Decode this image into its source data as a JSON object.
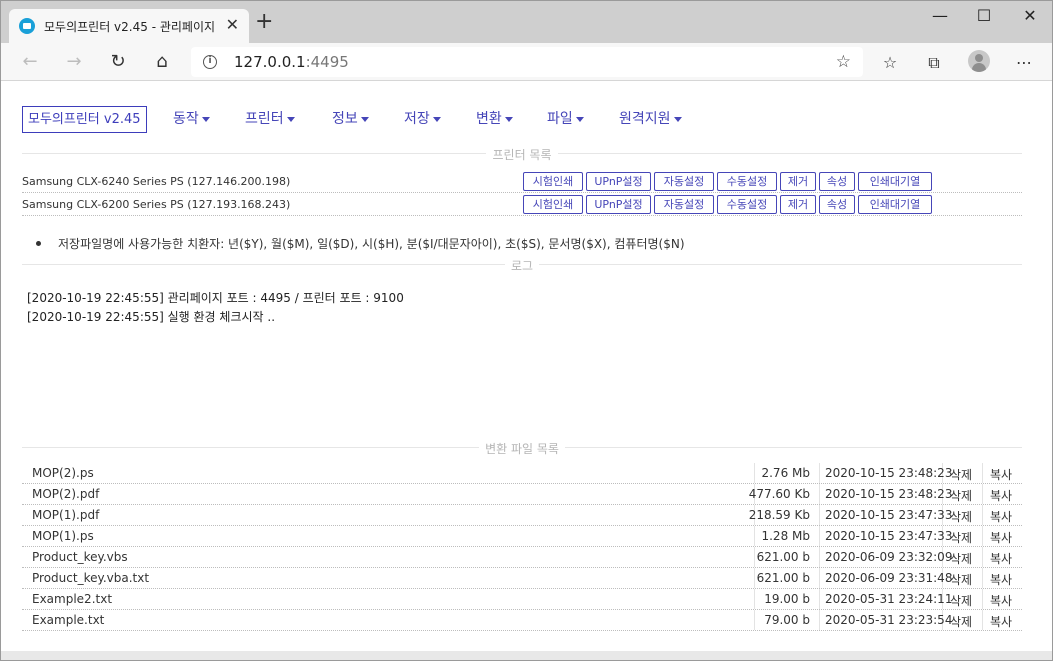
{
  "browser": {
    "tab_title": "모두의프린터 v2.45 - 관리페이지",
    "url_host": "127.0.0.1",
    "url_port": ":4495"
  },
  "navbar": {
    "brand": "모두의프린터 v2.45",
    "menus": [
      "동작",
      "프린터",
      "정보",
      "저장",
      "변환",
      "파일",
      "원격지원"
    ]
  },
  "printers": {
    "title": "프린터 목록",
    "button_labels": [
      "시험인쇄",
      "UPnP설정",
      "자동설정",
      "수동설정",
      "제거",
      "속성",
      "인쇄대기열"
    ],
    "rows": [
      {
        "name": "Samsung CLX-6240 Series PS (127.146.200.198)"
      },
      {
        "name": "Samsung CLX-6200 Series PS (127.193.168.243)"
      }
    ]
  },
  "note": "저장파일명에 사용가능한 치환자: 년($Y), 월($M), 일($D), 시($H), 분($I/대문자아이), 초($S), 문서명($X), 컴퓨터명($N)",
  "log": {
    "title": "로그",
    "lines": [
      "[2020-10-19 22:45:55] 관리페이지 포트 : 4495 / 프린터 포트 : 9100",
      "[2020-10-19 22:45:55] 실행 환경 체크시작 .."
    ]
  },
  "files": {
    "title": "변환 파일 목록",
    "delete_label": "삭제",
    "copy_label": "복사",
    "rows": [
      {
        "name": "MOP(2).ps",
        "size": "2.76 Mb",
        "date": "2020-10-15 23:48:23"
      },
      {
        "name": "MOP(2).pdf",
        "size": "477.60 Kb",
        "date": "2020-10-15 23:48:23"
      },
      {
        "name": "MOP(1).pdf",
        "size": "218.59 Kb",
        "date": "2020-10-15 23:47:33"
      },
      {
        "name": "MOP(1).ps",
        "size": "1.28 Mb",
        "date": "2020-10-15 23:47:33"
      },
      {
        "name": "Product_key.vbs",
        "size": "621.00 b",
        "date": "2020-06-09 23:32:09"
      },
      {
        "name": "Product_key.vba.txt",
        "size": "621.00 b",
        "date": "2020-06-09 23:31:48"
      },
      {
        "name": "Example2.txt",
        "size": "19.00 b",
        "date": "2020-05-31 23:24:11"
      },
      {
        "name": "Example.txt",
        "size": "79.00 b",
        "date": "2020-05-31 23:23:54"
      }
    ]
  }
}
